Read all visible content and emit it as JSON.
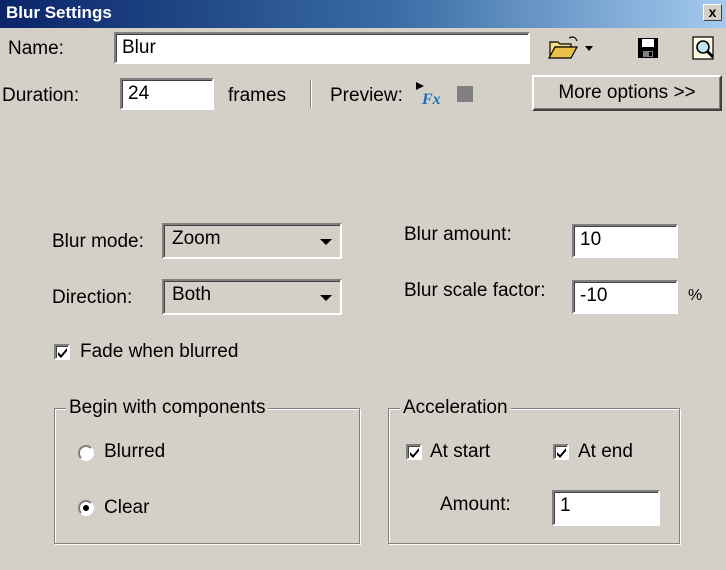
{
  "window": {
    "title": "Blur Settings",
    "close_glyph": "x"
  },
  "name": {
    "label": "Name:",
    "value": "Blur"
  },
  "duration": {
    "label": "Duration:",
    "value": "24",
    "unit": "frames"
  },
  "preview": {
    "label": "Preview:"
  },
  "toolbar": {
    "open_icon": "open-folder-icon",
    "save_icon": "floppy-disk-icon",
    "browse_icon": "magnify-page-icon"
  },
  "more_options": {
    "label": "More options >>"
  },
  "blur_mode": {
    "label": "Blur mode:",
    "value": "Zoom"
  },
  "direction": {
    "label": "Direction:",
    "value": "Both"
  },
  "blur_amount": {
    "label": "Blur amount:",
    "value": "10"
  },
  "blur_scale": {
    "label": "Blur scale factor:",
    "value": "-10",
    "unit": "%"
  },
  "fade": {
    "label": "Fade when blurred",
    "checked": true
  },
  "begin_group": {
    "title": "Begin with components",
    "options": [
      {
        "label": "Blurred",
        "selected": false
      },
      {
        "label": "Clear",
        "selected": true
      }
    ]
  },
  "acceleration": {
    "title": "Acceleration",
    "at_start": {
      "label": "At start",
      "checked": true
    },
    "at_end": {
      "label": "At end",
      "checked": true
    },
    "amount": {
      "label": "Amount:",
      "value": "1"
    }
  },
  "colors": {
    "titlebar_start": "#0a246a",
    "titlebar_end": "#a6caf0",
    "face": "#d4d0c8"
  }
}
